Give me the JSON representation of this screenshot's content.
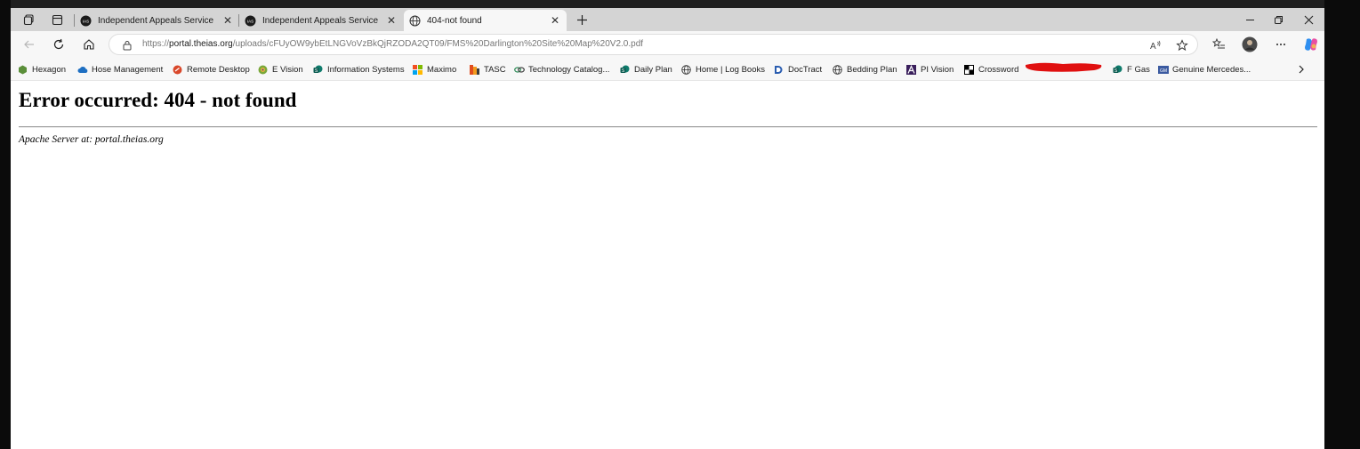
{
  "tabs": [
    {
      "title": "Independent Appeals Service",
      "active": false
    },
    {
      "title": "Independent Appeals Service",
      "active": false
    },
    {
      "title": "404-not found",
      "active": true
    }
  ],
  "address_bar": {
    "scheme": "https://",
    "host": "portal.theias.org",
    "path": "/uploads/cFUyOW9ybEtLNGVoVzBkQjRZODA2QT09/FMS%20Darlington%20Site%20Map%20V2.0.pdf"
  },
  "bookmarks": [
    {
      "label": "Hexagon",
      "icon": "hexagon-icon",
      "color": "#5b8f3a"
    },
    {
      "label": "Hose Management",
      "icon": "cloud-icon",
      "color": "#1e6fc2"
    },
    {
      "label": "Remote Desktop",
      "icon": "remote-desktop-icon",
      "color": "#d9482b"
    },
    {
      "label": "E Vision",
      "icon": "evision-icon",
      "color": "#7aa83a"
    },
    {
      "label": "Information Systems",
      "icon": "sharepoint-icon",
      "color": "#0f7b6c"
    },
    {
      "label": "Maximo",
      "icon": "microsoft-icon",
      "color": "#f25022"
    },
    {
      "label": "TASC",
      "icon": "tasc-icon",
      "color": "#e04d1f"
    },
    {
      "label": "Technology Catalog...",
      "icon": "link-icon",
      "color": "#2e8b57"
    },
    {
      "label": "Daily Plan",
      "icon": "sharepoint-icon",
      "color": "#0f7b6c"
    },
    {
      "label": "Home | Log Books",
      "icon": "globe-icon",
      "color": "#333333"
    },
    {
      "label": "DocTract",
      "icon": "doctract-icon",
      "color": "#2a5db0"
    },
    {
      "label": "Bedding Plan",
      "icon": "globe-icon",
      "color": "#333333"
    },
    {
      "label": "PI Vision",
      "icon": "pi-vision-icon",
      "color": "#3a1f5c"
    },
    {
      "label": "Crossword",
      "icon": "crossword-icon",
      "color": "#000000"
    },
    {
      "label": "",
      "icon": "redacted-mark",
      "color": "#e01010"
    },
    {
      "label": "F Gas",
      "icon": "sharepoint-icon",
      "color": "#0f7b6c"
    },
    {
      "label": "Genuine Mercedes...",
      "icon": "mercedes-icon",
      "color": "#3b5aa0"
    }
  ],
  "page": {
    "heading": "Error occurred: 404 - not found",
    "address_line": "Apache Server at: portal.theias.org"
  }
}
